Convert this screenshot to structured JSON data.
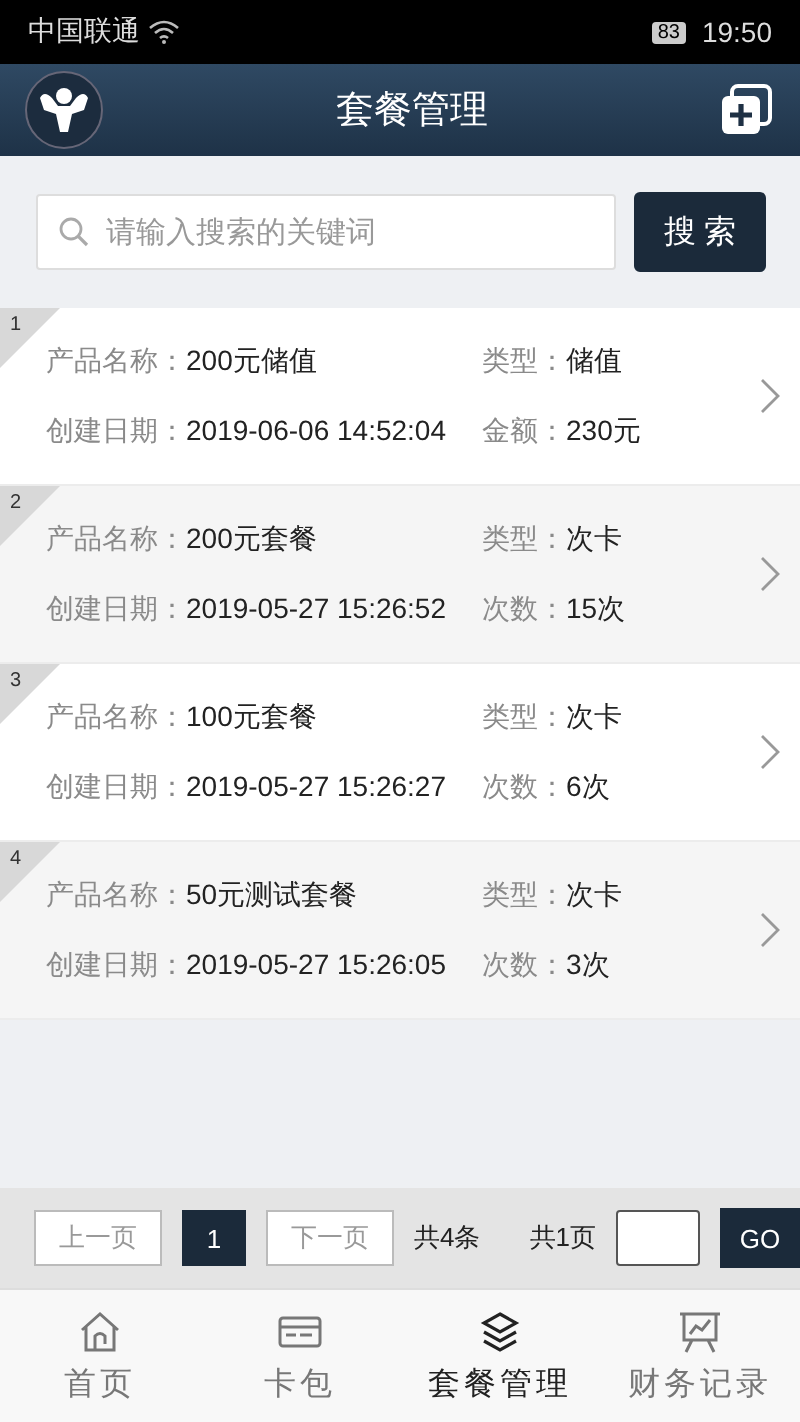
{
  "status_bar": {
    "carrier": "中国联通",
    "battery": "83",
    "time": "19:50"
  },
  "header": {
    "title": "套餐管理"
  },
  "search": {
    "placeholder": "请输入搜索的关键词",
    "button": "搜 索"
  },
  "packages": [
    {
      "index": "1",
      "fields": [
        {
          "label": "产品名称：",
          "value": "200元储值"
        },
        {
          "label": "类型：",
          "value": "储值"
        },
        {
          "label": "创建日期：",
          "value": "2019-06-06 14:52:04"
        },
        {
          "label": "金额：",
          "value": "230元"
        }
      ]
    },
    {
      "index": "2",
      "fields": [
        {
          "label": "产品名称：",
          "value": "200元套餐"
        },
        {
          "label": "类型：",
          "value": "次卡"
        },
        {
          "label": "创建日期：",
          "value": "2019-05-27 15:26:52"
        },
        {
          "label": "次数：",
          "value": "15次"
        }
      ]
    },
    {
      "index": "3",
      "fields": [
        {
          "label": "产品名称：",
          "value": "100元套餐"
        },
        {
          "label": "类型：",
          "value": "次卡"
        },
        {
          "label": "创建日期：",
          "value": "2019-05-27 15:26:27"
        },
        {
          "label": "次数：",
          "value": "6次"
        }
      ]
    },
    {
      "index": "4",
      "fields": [
        {
          "label": "产品名称：",
          "value": "50元测试套餐"
        },
        {
          "label": "类型：",
          "value": "次卡"
        },
        {
          "label": "创建日期：",
          "value": "2019-05-27 15:26:05"
        },
        {
          "label": "次数：",
          "value": "3次"
        }
      ]
    }
  ],
  "pagination": {
    "prev": "上一页",
    "pages": [
      {
        "label": "1",
        "selected": true
      }
    ],
    "next": "下一页",
    "total_items": "共4条",
    "total_pages": "共1页",
    "go": "GO"
  },
  "tabs": [
    {
      "label": "首页",
      "selected": false
    },
    {
      "label": "卡包",
      "selected": false
    },
    {
      "label": "套餐管理",
      "selected": true
    },
    {
      "label": "财务记录",
      "selected": false
    }
  ]
}
